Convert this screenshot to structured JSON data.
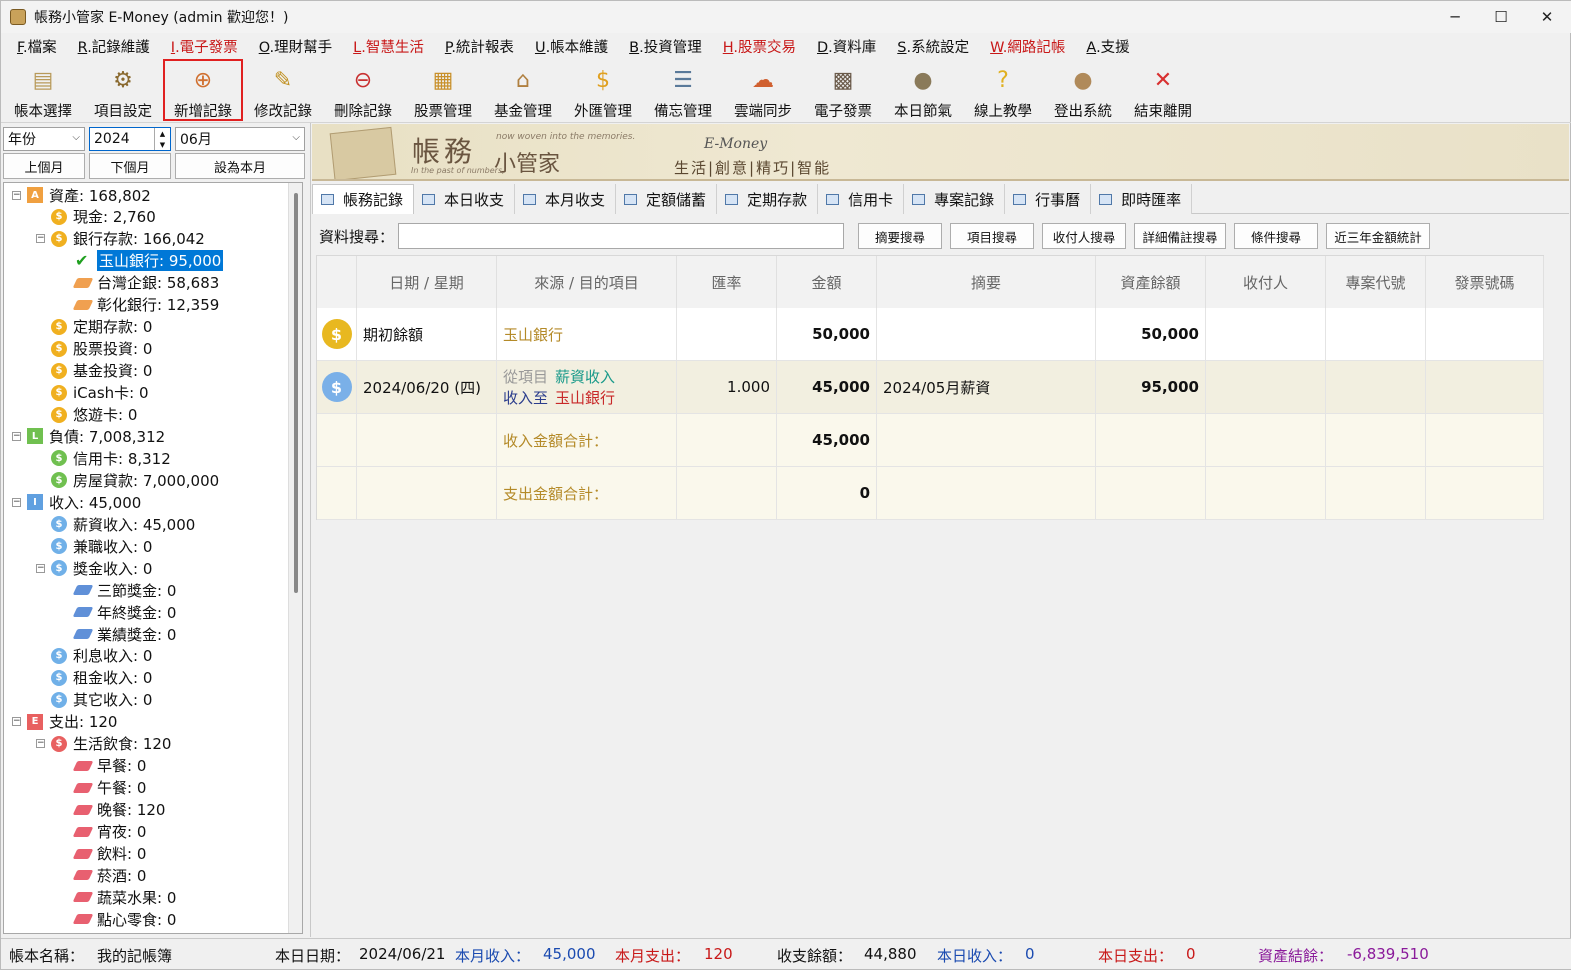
{
  "window": {
    "title": "帳務小管家 E-Money (admin 歡迎您！)",
    "minimize": "─",
    "maximize": "☐",
    "close": "✕"
  },
  "menu": [
    {
      "key": "F",
      "label": ".檔案",
      "red": false
    },
    {
      "key": "R",
      "label": ".記錄維護",
      "red": false
    },
    {
      "key": "I",
      "label": ".電子發票",
      "red": true
    },
    {
      "key": "O",
      "label": ".理財幫手",
      "red": false
    },
    {
      "key": "L",
      "label": ".智慧生活",
      "red": true
    },
    {
      "key": "P",
      "label": ".統計報表",
      "red": false
    },
    {
      "key": "U",
      "label": ".帳本維護",
      "red": false
    },
    {
      "key": "B",
      "label": ".投資管理",
      "red": false
    },
    {
      "key": "H",
      "label": ".股票交易",
      "red": true
    },
    {
      "key": "D",
      "label": ".資料庫",
      "red": false
    },
    {
      "key": "S",
      "label": ".系統設定",
      "red": false
    },
    {
      "key": "W",
      "label": ".網路記帳",
      "red": true
    },
    {
      "key": "A",
      "label": ".支援",
      "red": false
    }
  ],
  "toolbar": [
    {
      "label": "帳本選擇",
      "icon": "ledger-icon",
      "glyph": "▤",
      "color": "#b89a5a"
    },
    {
      "label": "項目設定",
      "icon": "gear-icon",
      "glyph": "⚙",
      "color": "#8a6a30"
    },
    {
      "label": "新增記錄",
      "icon": "add-record-icon",
      "glyph": "⊕",
      "color": "#d07030",
      "active": true
    },
    {
      "label": "修改記錄",
      "icon": "edit-record-icon",
      "glyph": "✎",
      "color": "#c09020"
    },
    {
      "label": "刪除記錄",
      "icon": "delete-record-icon",
      "glyph": "⊖",
      "color": "#c83030"
    },
    {
      "label": "股票管理",
      "icon": "stock-icon",
      "glyph": "▦",
      "color": "#c8902a"
    },
    {
      "label": "基金管理",
      "icon": "fund-icon",
      "glyph": "⌂",
      "color": "#b08040"
    },
    {
      "label": "外匯管理",
      "icon": "forex-icon",
      "glyph": "$",
      "color": "#e0a020"
    },
    {
      "label": "備忘管理",
      "icon": "memo-icon",
      "glyph": "☰",
      "color": "#5a7a9a"
    },
    {
      "label": "雲端同步",
      "icon": "cloud-sync-icon",
      "glyph": "☁",
      "color": "#d06030"
    },
    {
      "label": "電子發票",
      "icon": "qr-code-icon",
      "glyph": "▩",
      "color": "#6a5a4a"
    },
    {
      "label": "本日節氣",
      "icon": "solar-term-icon",
      "glyph": "●",
      "color": "#8a7a5a"
    },
    {
      "label": "線上教學",
      "icon": "help-icon",
      "glyph": "?",
      "color": "#e0b020"
    },
    {
      "label": "登出系統",
      "icon": "logout-icon",
      "glyph": "●",
      "color": "#b08a5a"
    },
    {
      "label": "結束離開",
      "icon": "exit-icon",
      "glyph": "✕",
      "color": "#d83030"
    }
  ],
  "filters": {
    "period_type": "年份",
    "year": "2024",
    "month": "06月",
    "prev_month": "上個月",
    "next_month": "下個月",
    "set_this_month": "設為本月"
  },
  "tree": [
    {
      "level": 0,
      "label": "資產: 168,802",
      "kind": "sq",
      "badge": "A",
      "color": "#f0a040",
      "toggle": "−"
    },
    {
      "level": 1,
      "label": "現金: 2,760",
      "kind": "coin",
      "color": "#f0b020"
    },
    {
      "level": 1,
      "label": "銀行存款: 166,042",
      "kind": "coin",
      "color": "#f0b020",
      "toggle": "−"
    },
    {
      "level": 2,
      "label": "玉山銀行: 95,000",
      "kind": "check",
      "color": "#20a020",
      "selected": true
    },
    {
      "level": 2,
      "label": "台灣企銀: 58,683",
      "kind": "leaf",
      "color": "#f0a050"
    },
    {
      "level": 2,
      "label": "彰化銀行: 12,359",
      "kind": "leaf",
      "color": "#f0a050"
    },
    {
      "level": 1,
      "label": "定期存款: 0",
      "kind": "coin",
      "color": "#f0b020"
    },
    {
      "level": 1,
      "label": "股票投資: 0",
      "kind": "coin",
      "color": "#f0b020"
    },
    {
      "level": 1,
      "label": "基金投資: 0",
      "kind": "coin",
      "color": "#f0b020"
    },
    {
      "level": 1,
      "label": "iCash卡: 0",
      "kind": "coin",
      "color": "#f0b020"
    },
    {
      "level": 1,
      "label": "悠遊卡: 0",
      "kind": "coin",
      "color": "#f0b020"
    },
    {
      "level": 0,
      "label": "負債: 7,008,312",
      "kind": "sq",
      "badge": "L",
      "color": "#70c050",
      "toggle": "−"
    },
    {
      "level": 1,
      "label": "信用卡: 8,312",
      "kind": "coin",
      "color": "#70c050"
    },
    {
      "level": 1,
      "label": "房屋貸款: 7,000,000",
      "kind": "coin",
      "color": "#70c050"
    },
    {
      "level": 0,
      "label": "收入: 45,000",
      "kind": "sq",
      "badge": "I",
      "color": "#60a0e0",
      "toggle": "−"
    },
    {
      "level": 1,
      "label": "薪資收入: 45,000",
      "kind": "coin",
      "color": "#70b0e8"
    },
    {
      "level": 1,
      "label": "兼職收入: 0",
      "kind": "coin",
      "color": "#70b0e8"
    },
    {
      "level": 1,
      "label": "獎金收入: 0",
      "kind": "coin",
      "color": "#70b0e8",
      "toggle": "−"
    },
    {
      "level": 2,
      "label": "三節獎金: 0",
      "kind": "leaf",
      "color": "#6090d8"
    },
    {
      "level": 2,
      "label": "年終獎金: 0",
      "kind": "leaf",
      "color": "#6090d8"
    },
    {
      "level": 2,
      "label": "業績獎金: 0",
      "kind": "leaf",
      "color": "#6090d8"
    },
    {
      "level": 1,
      "label": "利息收入: 0",
      "kind": "coin",
      "color": "#70b0e8"
    },
    {
      "level": 1,
      "label": "租金收入: 0",
      "kind": "coin",
      "color": "#70b0e8"
    },
    {
      "level": 1,
      "label": "其它收入: 0",
      "kind": "coin",
      "color": "#70b0e8"
    },
    {
      "level": 0,
      "label": "支出: 120",
      "kind": "sq",
      "badge": "E",
      "color": "#e86060",
      "toggle": "−"
    },
    {
      "level": 1,
      "label": "生活飲食: 120",
      "kind": "coin",
      "color": "#e86060",
      "toggle": "−"
    },
    {
      "level": 2,
      "label": "早餐: 0",
      "kind": "leaf",
      "color": "#e86070"
    },
    {
      "level": 2,
      "label": "午餐: 0",
      "kind": "leaf",
      "color": "#e86070"
    },
    {
      "level": 2,
      "label": "晚餐: 120",
      "kind": "leaf",
      "color": "#e86070"
    },
    {
      "level": 2,
      "label": "宵夜: 0",
      "kind": "leaf",
      "color": "#e86070"
    },
    {
      "level": 2,
      "label": "飲料: 0",
      "kind": "leaf",
      "color": "#e86070"
    },
    {
      "level": 2,
      "label": "菸酒: 0",
      "kind": "leaf",
      "color": "#e86070"
    },
    {
      "level": 2,
      "label": "蔬菜水果: 0",
      "kind": "leaf",
      "color": "#e86070"
    },
    {
      "level": 2,
      "label": "點心零食: 0",
      "kind": "leaf",
      "color": "#e86070"
    }
  ],
  "banner": {
    "title": "帳務",
    "title2": "小管家",
    "english": "E-Money",
    "slogan": "生活|創意|精巧|智能",
    "small_text": "now woven into the memories.",
    "small_text2": "In the past of numbers,"
  },
  "tabs": [
    "帳務記錄",
    "本日收支",
    "本月收支",
    "定額儲蓄",
    "定期存款",
    "信用卡",
    "專案記錄",
    "行事曆",
    "即時匯率"
  ],
  "search": {
    "label": "資料搜尋：",
    "value": "",
    "buttons": [
      "摘要搜尋",
      "項目搜尋",
      "收付人搜尋",
      "詳細備註搜尋",
      "條件搜尋",
      "近三年金額統計"
    ]
  },
  "grid": {
    "headers": [
      "",
      "日期 / 星期",
      "來源 / 目的項目",
      "匯率",
      "金額",
      "摘要",
      "資產餘額",
      "收付人",
      "專案代號",
      "發票號碼"
    ],
    "opening": {
      "label": "期初餘額",
      "account": "玉山銀行",
      "amount": "50,000",
      "balance": "50,000"
    },
    "record": {
      "date": "2024/06/20 (四)",
      "from_label": "從項目",
      "from_value": "薪資收入",
      "to_label": "收入至",
      "to_value": "玉山銀行",
      "rate": "1.000",
      "amount": "45,000",
      "memo": "2024/05月薪資",
      "balance": "95,000"
    },
    "income_total_label": "收入金額合計：",
    "income_total": "45,000",
    "expense_total_label": "支出金額合計：",
    "expense_total": "0"
  },
  "status": {
    "book_label": "帳本名稱：",
    "book_value": "我的記帳簿",
    "date_label": "本日日期：",
    "date_value": "2024/06/21",
    "month_income_label": "本月收入：",
    "month_income_value": "45,000",
    "month_expense_label": "本月支出：",
    "month_expense_value": "120",
    "balance_label": "收支餘額：",
    "balance_value": "44,880",
    "day_income_label": "本日收入：",
    "day_income_value": "0",
    "day_expense_label": "本日支出：",
    "day_expense_value": "0",
    "asset_label": "資產結餘：",
    "asset_value": "-6,839,510"
  }
}
